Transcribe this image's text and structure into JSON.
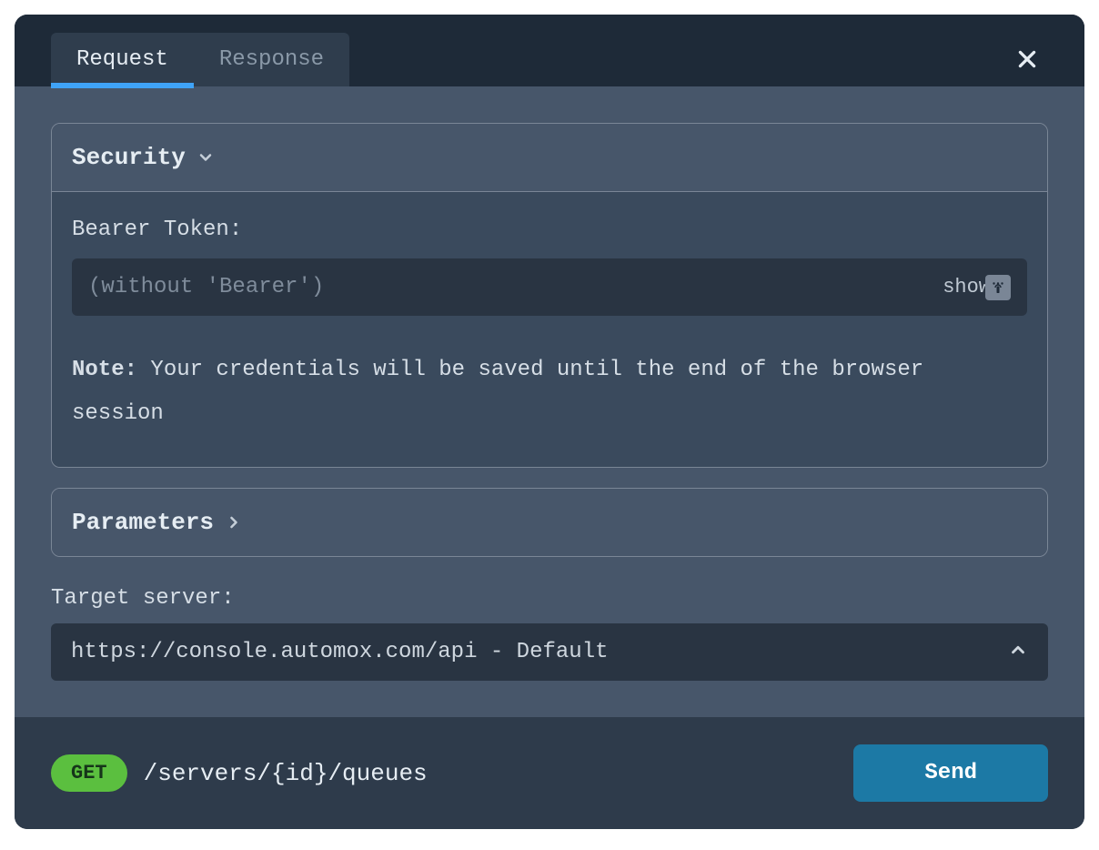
{
  "tabs": {
    "request": "Request",
    "response": "Response",
    "active": "request"
  },
  "security": {
    "title": "Security",
    "bearer_label": "Bearer Token:",
    "bearer_placeholder": "(without 'Bearer')",
    "show_label": "show",
    "note_prefix": "Note:",
    "note_body": " Your credentials will be saved until the end of the browser session"
  },
  "parameters": {
    "title": "Parameters"
  },
  "target": {
    "label": "Target server:",
    "value": "https://console.automox.com/api - Default"
  },
  "footer": {
    "method": "GET",
    "path": "/servers/{id}/queues",
    "send_label": "Send"
  }
}
